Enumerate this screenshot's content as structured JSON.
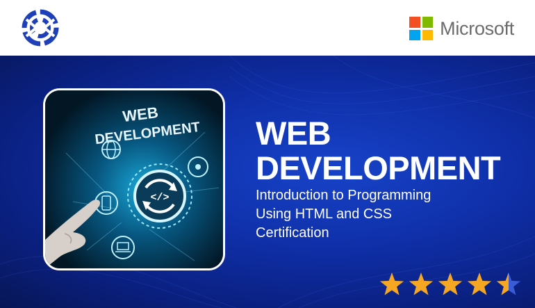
{
  "header": {
    "brand_logo_icon": "circular-c-logo-icon",
    "partner_name": "Microsoft",
    "partner_colors": [
      "#f25022",
      "#7fba00",
      "#00a4ef",
      "#ffb900"
    ]
  },
  "hero": {
    "title_line1": "WEB",
    "title_line2": "DEVELOPMENT",
    "subtitle_line1": "Introduction to Programming",
    "subtitle_line2": "Using HTML and CSS",
    "subtitle_line3": "Certification",
    "image": {
      "caption_line1": "WEB",
      "caption_line2": "DEVELOPMENT",
      "center_icon": "code-sync-icon",
      "node_icons": [
        "globe-icon",
        "mobile-icon",
        "network-icon",
        "laptop-icon"
      ]
    },
    "rating": {
      "value": 4.5,
      "max": 5
    },
    "colors": {
      "background": "#0f2fa8",
      "accent_star": "#f5a623"
    }
  }
}
